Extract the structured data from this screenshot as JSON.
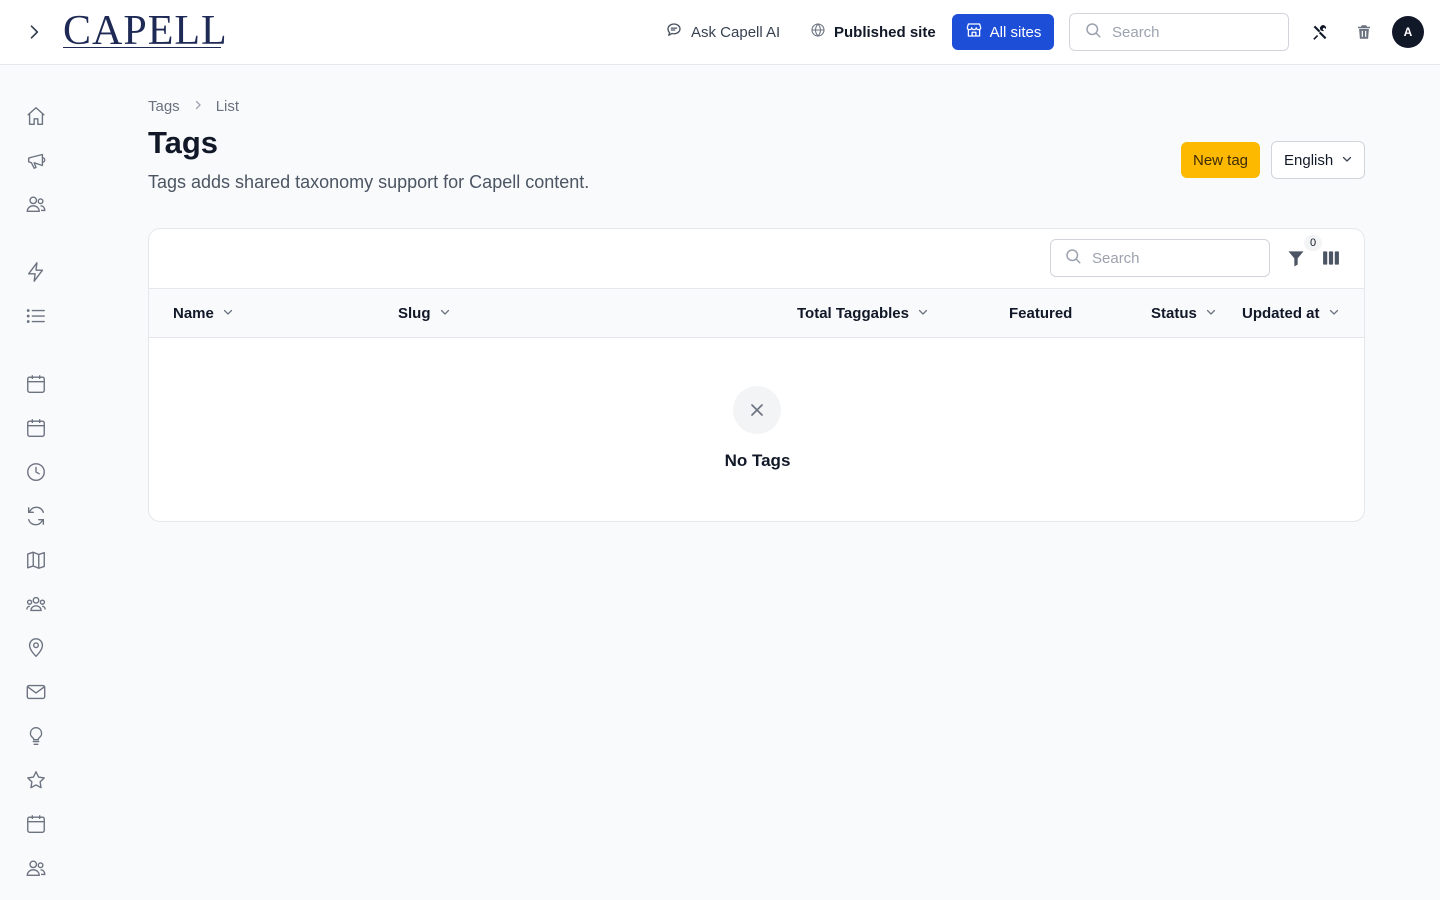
{
  "app": {
    "logo_text": "CAPELL"
  },
  "topnav": {
    "ask_ai": "Ask Capell AI",
    "published_site": "Published site",
    "all_sites": "All sites",
    "search_placeholder": "Search",
    "avatar_initial": "A"
  },
  "sidebar": {
    "icons": [
      "home-icon",
      "megaphone-icon",
      "users-icon",
      "bolt-icon",
      "list-icon",
      "calendar-icon",
      "calendar-grid-icon",
      "clock-icon",
      "refresh-icon",
      "map-icon",
      "user-group-icon",
      "map-pin-icon",
      "envelope-icon",
      "lightbulb-icon",
      "star-icon",
      "calendar-days-icon",
      "users-alt-icon"
    ]
  },
  "breadcrumb": {
    "items": [
      "Tags",
      "List"
    ]
  },
  "page": {
    "title": "Tags",
    "description": "Tags adds shared taxonomy support for Capell content.",
    "new_button": "New tag",
    "language": "English"
  },
  "table": {
    "search_placeholder": "Search",
    "filter_count": "0",
    "columns": [
      {
        "label": "Name",
        "sortable": true
      },
      {
        "label": "Slug",
        "sortable": true
      },
      {
        "label": "Total Taggables",
        "sortable": true
      },
      {
        "label": "Featured",
        "sortable": false
      },
      {
        "label": "Status",
        "sortable": true
      },
      {
        "label": "Updated at",
        "sortable": true
      }
    ],
    "empty_title": "No Tags"
  },
  "colors": {
    "primary": "#1d4ed8",
    "accent": "#fcb900",
    "text": "#111827",
    "muted": "#6b7280"
  }
}
